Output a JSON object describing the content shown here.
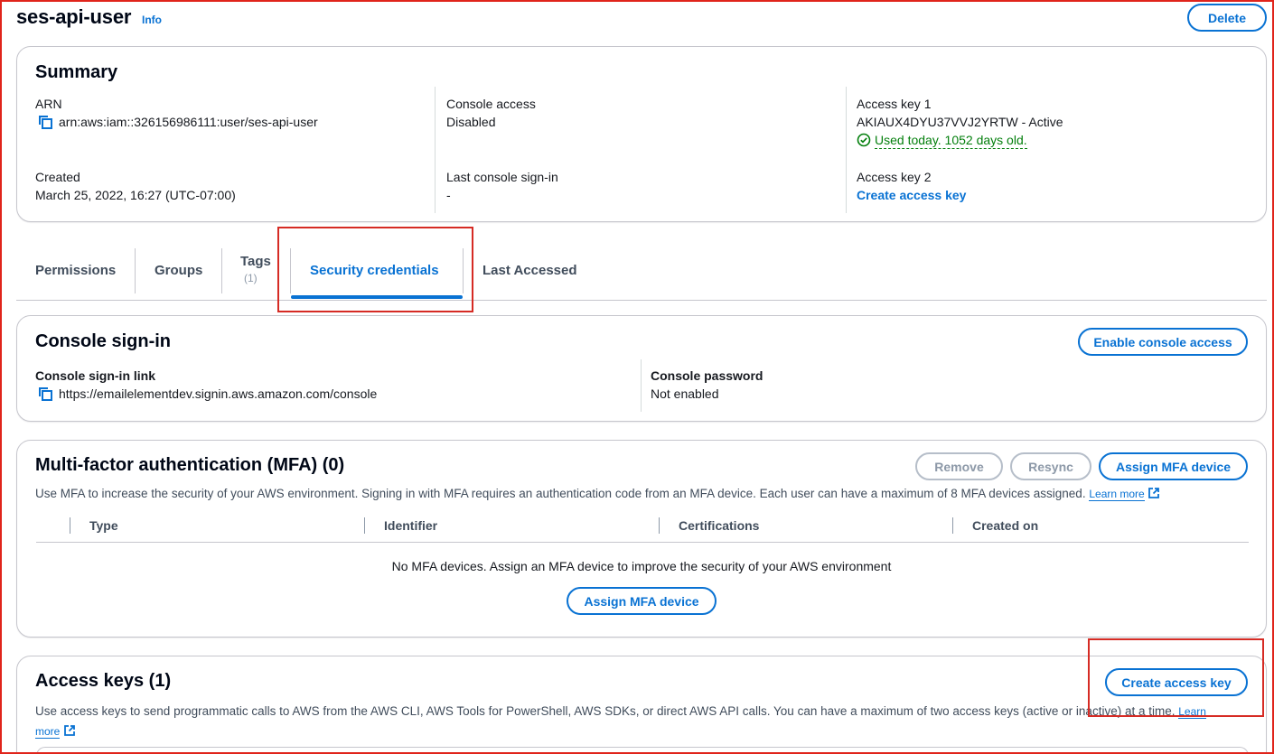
{
  "page": {
    "title": "ses-api-user",
    "info_label": "Info",
    "delete_label": "Delete"
  },
  "summary": {
    "heading": "Summary",
    "arn_label": "ARN",
    "arn_value": "arn:aws:iam::326156986111:user/ses-api-user",
    "created_label": "Created",
    "created_value": "March 25, 2022, 16:27 (UTC-07:00)",
    "console_access_label": "Console access",
    "console_access_value": "Disabled",
    "last_signin_label": "Last console sign-in",
    "last_signin_value": "-",
    "access_key1_label": "Access key 1",
    "access_key1_value": "AKIAUX4DYU37VVJ2YRTW - Active",
    "access_key1_status": "Used today. 1052 days old.",
    "access_key2_label": "Access key 2",
    "create_access_key_link": "Create access key"
  },
  "tabs": [
    {
      "label": "Permissions"
    },
    {
      "label": "Groups"
    },
    {
      "label": "Tags",
      "count": "(1)"
    },
    {
      "label": "Security credentials",
      "active": true
    },
    {
      "label": "Last Accessed"
    }
  ],
  "console_signin": {
    "heading": "Console sign-in",
    "enable_button": "Enable console access",
    "link_label": "Console sign-in link",
    "link_value": "https://emailelementdev.signin.aws.amazon.com/console",
    "password_label": "Console password",
    "password_value": "Not enabled"
  },
  "mfa": {
    "heading": "Multi-factor authentication (MFA) (0)",
    "remove_button": "Remove",
    "resync_button": "Resync",
    "assign_button": "Assign MFA device",
    "description": "Use MFA to increase the security of your AWS environment. Signing in with MFA requires an authentication code from an MFA device. Each user can have a maximum of 8 MFA devices assigned.",
    "learn_more": "Learn more",
    "columns": [
      "Type",
      "Identifier",
      "Certifications",
      "Created on"
    ],
    "empty_message": "No MFA devices. Assign an MFA device to improve the security of your AWS environment",
    "empty_assign_button": "Assign MFA device"
  },
  "access_keys": {
    "heading": "Access keys (1)",
    "create_button": "Create access key",
    "description": "Use access keys to send programmatic calls to AWS from the AWS CLI, AWS Tools for PowerShell, AWS SDKs, or direct AWS API calls. You can have a maximum of two access keys (active or inactive) at a time.",
    "learn": "Learn",
    "more": "more"
  },
  "colors": {
    "accent": "#0972d3",
    "success": "#037f0c",
    "highlight_border": "#d62b24"
  }
}
